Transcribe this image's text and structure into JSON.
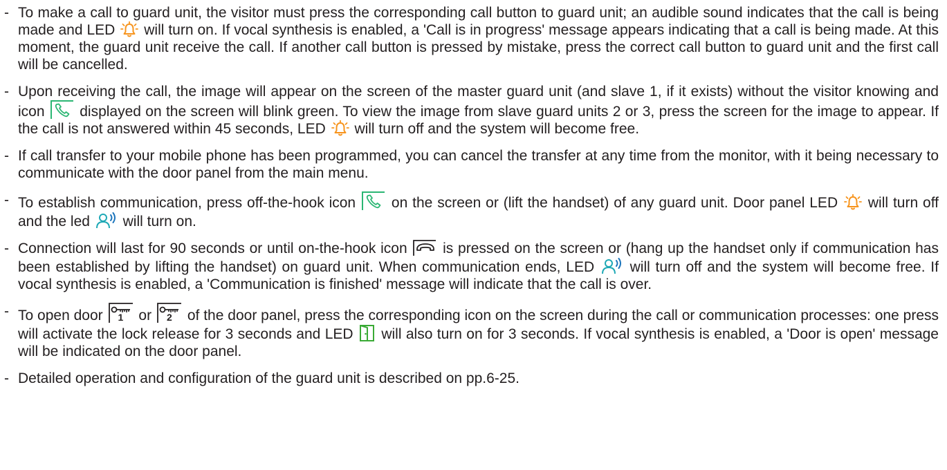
{
  "dash": "-",
  "colors": {
    "text": "#231f20",
    "bell_orange": "#f7941d",
    "handset_green": "#2bb673",
    "person_teal": "#1fa9b6",
    "audio_blue": "#1c75bc",
    "door_green": "#3aaa35"
  },
  "icons": {
    "bell": "bell-led-icon",
    "offhook": "off-the-hook-icon",
    "onhook": "on-the-hook-icon",
    "talk": "communication-led-icon",
    "key": "door-key-icon",
    "door": "door-open-led-icon"
  },
  "paragraphs": {
    "p1": {
      "a": "To make a call to guard unit, the visitor must press the corresponding call button to guard unit; an audible sound indicates that the call is being made and LED",
      "b": "will turn on. If vocal synthesis is enabled, a 'Call is in progress' message appears indicating that a call is being made. At this moment, the guard unit receive the call. If another call button is pressed by mistake, press the correct call button to guard unit and the first call will be cancelled."
    },
    "p2": {
      "a": "Upon receiving the call, the image will appear on the screen of the master guard unit (and slave 1, if it exists) without the visitor knowing and icon",
      "b": "displayed on the screen will blink green. To view the image from slave guard units 2 or 3, press the screen for the image to appear. If the call is not answered within 45 seconds, LED",
      "c": "will turn off and the system will become free."
    },
    "p3": {
      "a": "If call transfer to your mobile phone has been programmed, you can cancel the transfer at any time from the monitor, with it being necessary to communicate with the door panel from the main menu."
    },
    "p4": {
      "a": "To establish communication, press off-the-hook icon",
      "b": "on the screen or (lift the handset) of any guard unit. Door panel LED",
      "c": "will turn off and the led",
      "d": "will turn on."
    },
    "p5": {
      "a": "Connection will last for 90 seconds or until on-the-hook icon",
      "b": "is pressed on the screen or (hang up the handset only if communication has been established by lifting the handset) on guard unit. When communication ends, LED",
      "c": "will turn off and the system will become free. If vocal synthesis is enabled, a 'Communication is finished' message will indicate that the call is over."
    },
    "p6": {
      "a": "To open door",
      "key1": "1",
      "or": "or",
      "key2": "2",
      "b": "of the door panel, press the corresponding icon on the screen during the call or communication processes: one press will activate the lock release for 3 seconds and LED",
      "c": "will also turn on for 3 seconds. If vocal synthesis is enabled, a 'Door is open' message will be indicated on the door panel."
    },
    "p7": {
      "a": "Detailed operation and configuration of the guard unit is described on pp.6-25."
    }
  }
}
